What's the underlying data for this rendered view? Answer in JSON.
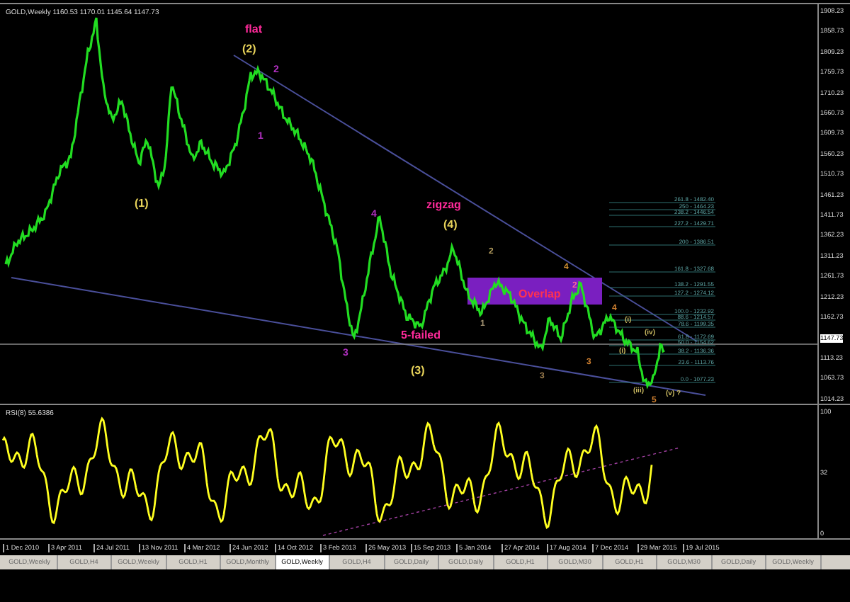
{
  "chart_header": "GOLD,Weekly  1160.53 1170.01 1145.64 1147.73",
  "wave_labels": [
    {
      "text": "flat",
      "color": "#ff2a9a"
    },
    {
      "text": "(2)",
      "color": "#e8d35a"
    },
    {
      "text": "2",
      "color": "#b030c0"
    },
    {
      "text": "1",
      "color": "#b030c0"
    },
    {
      "text": "(1)",
      "color": "#e8d35a"
    },
    {
      "text": "4",
      "color": "#b030c0"
    },
    {
      "text": "zigzag",
      "color": "#ff2a9a"
    },
    {
      "text": "(4)",
      "color": "#e8d35a"
    },
    {
      "text": "2",
      "color": "#b8a060"
    },
    {
      "text": "4",
      "color": "#d09030"
    },
    {
      "text": "Overlap",
      "color": "#ff3050"
    },
    {
      "text": "2",
      "color": "#ff60a0"
    },
    {
      "text": "1",
      "color": "#a09070"
    },
    {
      "text": "3",
      "color": "#b030c0"
    },
    {
      "text": "5-failed",
      "color": "#ff2a9a"
    },
    {
      "text": "(3)",
      "color": "#e8d35a"
    },
    {
      "text": "3",
      "color": "#a08050"
    },
    {
      "text": "3",
      "color": "#d08030"
    },
    {
      "text": "4",
      "color": "#d08030"
    },
    {
      "text": "(i)",
      "color": "#c8b860"
    },
    {
      "text": "(i)",
      "color": "#c8b860"
    },
    {
      "text": "(iv)",
      "color": "#c8b860"
    },
    {
      "text": "(iii)",
      "color": "#c8b860"
    },
    {
      "text": "(v) ?",
      "color": "#c8b860"
    },
    {
      "text": "5",
      "color": "#d08030"
    }
  ],
  "fib_levels": [
    "261.8 - 1482.40",
    "250 - 1464.23",
    "238.2 - 1446.54",
    "227.2 - 1429.71",
    "200 - 1386.51",
    "161.8 - 1327.68",
    "138.2 - 1291.55",
    "127.2 - 1274.12",
    "100.0 - 1232.92",
    "88.6 - 1214.57",
    "78.6 - 1199.35",
    "61.8 - 1172.69",
    "50.0 - 1154.62",
    "38.2 - 1136.36",
    "23.6 - 1113.76",
    "0.0 - 1077.23"
  ],
  "price_axis": [
    {
      "text": "1908.23",
      "kind": "tick"
    },
    {
      "text": "1858.73",
      "kind": "tick"
    },
    {
      "text": "1809.23",
      "kind": "tick"
    },
    {
      "text": "1759.73",
      "kind": "tick"
    },
    {
      "text": "1710.23",
      "kind": "tick"
    },
    {
      "text": "1660.73",
      "kind": "tick"
    },
    {
      "text": "1609.73",
      "kind": "tick"
    },
    {
      "text": "1560.23",
      "kind": "tick"
    },
    {
      "text": "1510.73",
      "kind": "tick"
    },
    {
      "text": "1461.23",
      "kind": "tick"
    },
    {
      "text": "1411.73",
      "kind": "tick"
    },
    {
      "text": "1362.23",
      "kind": "tick"
    },
    {
      "text": "1311.23",
      "kind": "tick"
    },
    {
      "text": "1261.73",
      "kind": "tick"
    },
    {
      "text": "1212.23",
      "kind": "tick"
    },
    {
      "text": "1162.73",
      "kind": "tick"
    },
    {
      "text": "1147.73",
      "kind": "current"
    },
    {
      "text": "1113.23",
      "kind": "tick"
    },
    {
      "text": "1063.73",
      "kind": "tick"
    },
    {
      "text": "1014.23",
      "kind": "tick"
    }
  ],
  "rsi_header": "RSI(8) 55.6386",
  "rsi_axis": [
    "100",
    "32",
    "0"
  ],
  "date_axis": [
    "1 Dec 2010",
    "3 Apr 2011",
    "24 Jul 2011",
    "13 Nov 2011",
    "4 Mar 2012",
    "24 Jun 2012",
    "14 Oct 2012",
    "3 Feb 2013",
    "26 May 2013",
    "15 Sep 2013",
    "5 Jan 2014",
    "27 Apr 2014",
    "17 Aug 2014",
    "7 Dec 2014",
    "29 Mar 2015",
    "19 Jul 2015"
  ],
  "tabs": [
    {
      "label": "GOLD,Weekly",
      "selected": false
    },
    {
      "label": "GOLD,H4",
      "selected": false
    },
    {
      "label": "GOLD,Weekly",
      "selected": false
    },
    {
      "label": "GOLD,H1",
      "selected": false
    },
    {
      "label": "GOLD,Monthly",
      "selected": false
    },
    {
      "label": "GOLD,Weekly",
      "selected": true
    },
    {
      "label": "GOLD,H4",
      "selected": false
    },
    {
      "label": "GOLD,Daily",
      "selected": false
    },
    {
      "label": "GOLD,Daily",
      "selected": false
    },
    {
      "label": "GOLD,H1",
      "selected": false
    },
    {
      "label": "GOLD,M30",
      "selected": false
    },
    {
      "label": "GOLD,H1",
      "selected": false
    },
    {
      "label": "GOLD,M30",
      "selected": false
    },
    {
      "label": "GOLD,Daily",
      "selected": false
    },
    {
      "label": "GOLD,Weekly",
      "selected": false
    }
  ]
}
